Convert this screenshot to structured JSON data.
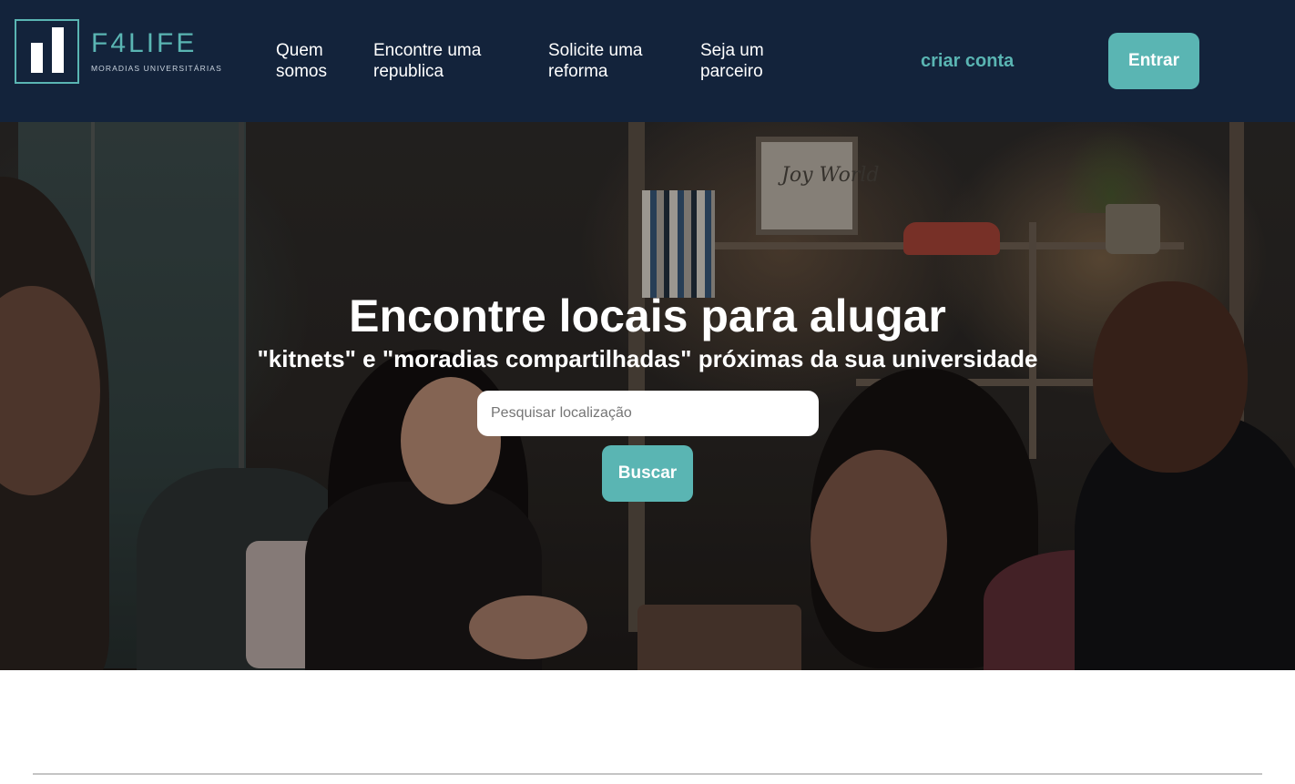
{
  "brand": {
    "name": "F4LIFE",
    "tagline": "MORADIAS UNIVERSITÁRIAS",
    "accent_color": "#5ab5b3",
    "header_bg": "#13233b"
  },
  "nav": {
    "quem_somos": "Quem somos",
    "encontre_republica": "Encontre uma republica",
    "solicite_reforma": "Solicite uma reforma",
    "seja_parceiro": "Seja um parceiro",
    "criar_conta": "criar conta",
    "entrar": "Entrar"
  },
  "hero": {
    "title": "Encontre locais para alugar",
    "subtitle": "\"kitnets\" e \"moradias compartilhadas\" próximas da sua universidade",
    "search_placeholder": "Pesquisar localização",
    "search_value": "",
    "search_button": "Buscar",
    "background_image": "photo-of-students-chatting-in-living-room"
  },
  "frame_text": "Joy World"
}
